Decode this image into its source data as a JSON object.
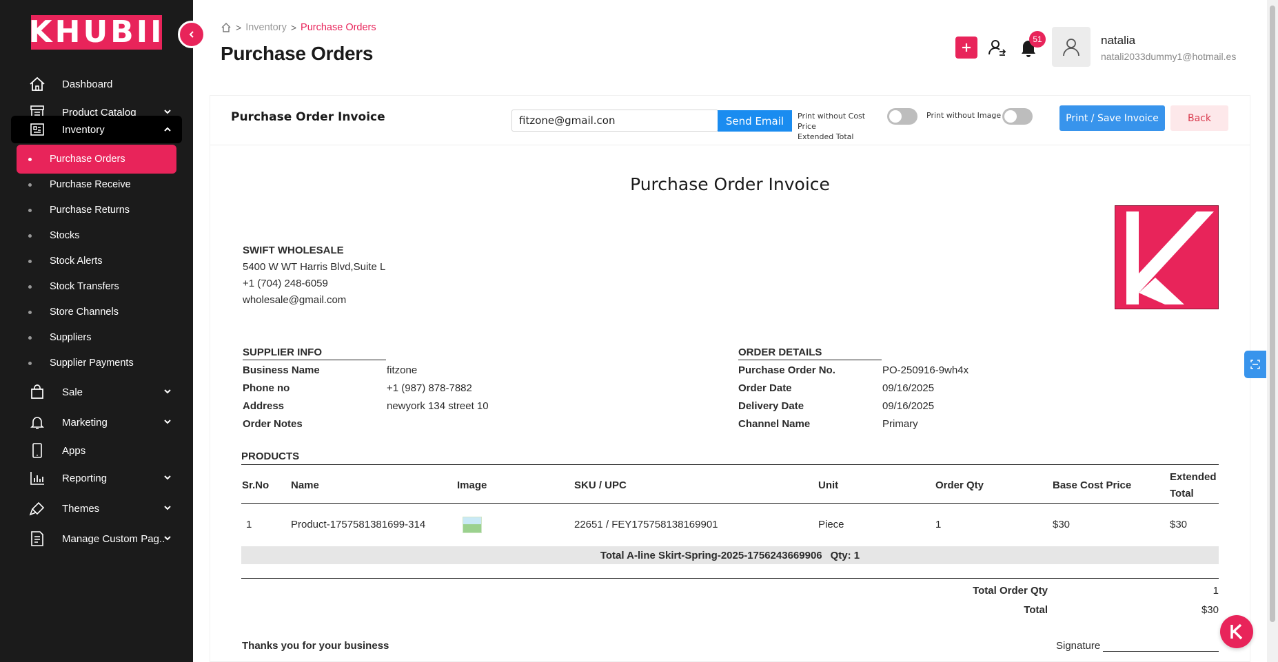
{
  "brand": {
    "logo_text": "KHUBII",
    "accent": "#e8245a"
  },
  "sidebar": {
    "items": [
      {
        "label": "Dashboard",
        "icon": "home-icon"
      },
      {
        "label": "Product Catalog",
        "icon": "store-icon"
      },
      {
        "label": "Inventory",
        "icon": "inventory-icon"
      },
      {
        "label": "Sale",
        "icon": "bag-icon"
      },
      {
        "label": "Marketing",
        "icon": "bell-icon"
      },
      {
        "label": "Apps",
        "icon": "tablet-icon"
      },
      {
        "label": "Reporting",
        "icon": "bar-chart-icon"
      },
      {
        "label": "Themes",
        "icon": "brush-icon"
      },
      {
        "label": "Manage Custom Pag..",
        "icon": "page-icon"
      }
    ],
    "inventory_sub": [
      {
        "label": "Purchase Orders"
      },
      {
        "label": "Purchase Receive"
      },
      {
        "label": "Purchase Returns"
      },
      {
        "label": "Stocks"
      },
      {
        "label": "Stock Alerts"
      },
      {
        "label": "Stock Transfers"
      },
      {
        "label": "Store Channels"
      },
      {
        "label": "Suppliers"
      },
      {
        "label": "Supplier Payments"
      }
    ]
  },
  "header": {
    "breadcrumb": {
      "parent": "Inventory",
      "current": "Purchase Orders"
    },
    "title": "Purchase Orders",
    "notifications_count": "51",
    "user": {
      "name": "natalia",
      "email": "natali2033dummy1@hotmail.es"
    }
  },
  "toolbar": {
    "card_title": "Purchase Order Invoice",
    "email_value": "fitzone@gmail.con",
    "send_label": "Send Email",
    "toggle1_label_line1": "Print without Cost Price",
    "toggle1_label_line2": "Extended Total",
    "toggle2_label": "Print without Image",
    "print_label": "Print / Save Invoice",
    "back_label": "Back"
  },
  "invoice": {
    "title": "Purchase Order Invoice",
    "company": {
      "name": "SWIFT WHOLESALE",
      "address": "5400 W WT Harris Blvd,Suite L",
      "phone": "+1 (704) 248-6059",
      "email": "wholesale@gmail.com"
    },
    "supplier": {
      "heading": "SUPPLIER INFO",
      "rows": [
        {
          "key": "Business Name",
          "value": "fitzone"
        },
        {
          "key": "Phone no",
          "value": "+1 (987) 878-7882"
        },
        {
          "key": "Address",
          "value": "newyork 134 street 10"
        },
        {
          "key": "Order Notes",
          "value": ""
        }
      ]
    },
    "order": {
      "heading": "ORDER DETAILS",
      "rows": [
        {
          "key": "Purchase Order No.",
          "value": "PO-250916-9wh4x"
        },
        {
          "key": "Order Date",
          "value": "09/16/2025"
        },
        {
          "key": "Delivery Date",
          "value": "09/16/2025"
        },
        {
          "key": "Channel Name",
          "value": "Primary"
        }
      ]
    },
    "products": {
      "heading": "PRODUCTS",
      "columns": [
        "Sr.No",
        "Name",
        "Image",
        "SKU / UPC",
        "Unit",
        "Order Qty",
        "Base Cost Price",
        "Extended",
        "Total"
      ],
      "rows": [
        {
          "sr": "1",
          "name": "Product-1757581381699-314",
          "sku": "22651 / FEY175758138169901",
          "unit": "Piece",
          "qty": "1",
          "base": "$30",
          "ext": "$30"
        }
      ],
      "group_total_label": "Total A-line Skirt-Spring-2025-1756243669906",
      "group_total_qty": "Qty: 1"
    },
    "summary": {
      "total_qty_label": "Total Order Qty",
      "total_qty": "1",
      "total_label": "Total",
      "total": "$30"
    },
    "footer": {
      "thanks": "Thanks you for your business",
      "signature_label": "Signature"
    }
  }
}
